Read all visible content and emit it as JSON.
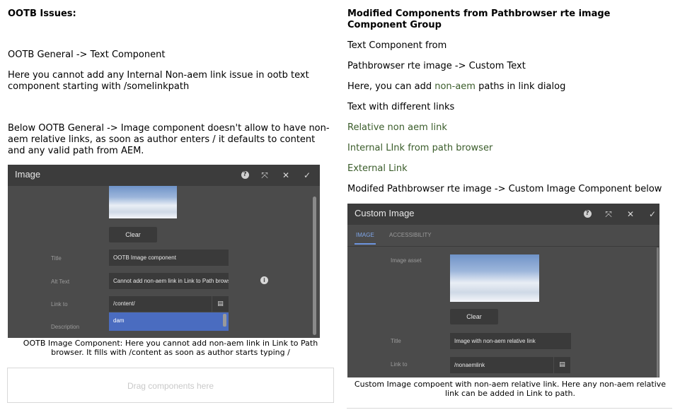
{
  "left": {
    "heading": "OOTB Issues:",
    "line1": "OOTB General -> Text  Component",
    "para1": "Here you cannot add any Internal Non-aem link issue in ootb text component starting with /somelinkpath",
    "para2": "Below OOTB  General -> Image component doesn't allow to have non-aem relative links, as soon as author enters / it defaults to content and any valid path from AEM.",
    "dialog": {
      "title": "Image",
      "clear_label": "Clear",
      "title_label": "Title",
      "title_value": "OOTB Image component",
      "alt_label": "Alt Text",
      "alt_value": "Cannot add non-aem link in Link to Path browser",
      "link_label": "Link to",
      "link_value": "/content/",
      "description_label": "Description",
      "suggestion": "dam"
    },
    "caption": "OOTB Image Component: Here you cannot add non-aem link in Link to Path browser. It fills with /content as soon as author starts typing /",
    "dropzone": "Drag components here"
  },
  "right": {
    "heading": "Modified Components from Pathbrowser rte image Component Group",
    "line1": "Text Component from",
    "line2": "Pathbrowser rte image -> Custom Text",
    "line3_prefix": "Here, you can add ",
    "line3_green": "non-aem",
    "line3_suffix": " paths in link dialog",
    "line4": "Text with different links",
    "link1": "Relative non aem link",
    "link2": "Internal LInk from path browser",
    "link3": "External Link",
    "line5": "Modifed Pathbrowser rte image -> Custom Image Component below",
    "dialog": {
      "title": "Custom Image",
      "tab_image": "IMAGE",
      "tab_accessibility": "ACCESSIBILITY",
      "asset_label": "Image asset",
      "clear_label": "Clear",
      "title_label": "Title",
      "title_value": "Image with non-aem relative link",
      "link_label": "Link to",
      "link_value": "/nonaemlink"
    },
    "caption": "Custom Image compoent with non-aem relative link. Here any non-aem relative link can be added in Link to path."
  },
  "colors": {
    "green_link": "#3a5c2a",
    "dialog_bg": "#4b4b4b",
    "dialog_header": "#3c3c3c",
    "accent": "#4a6cc0"
  },
  "icons": [
    "help-icon",
    "fullscreen-icon",
    "close-icon",
    "check-icon",
    "info-icon",
    "folder-browse-icon"
  ]
}
